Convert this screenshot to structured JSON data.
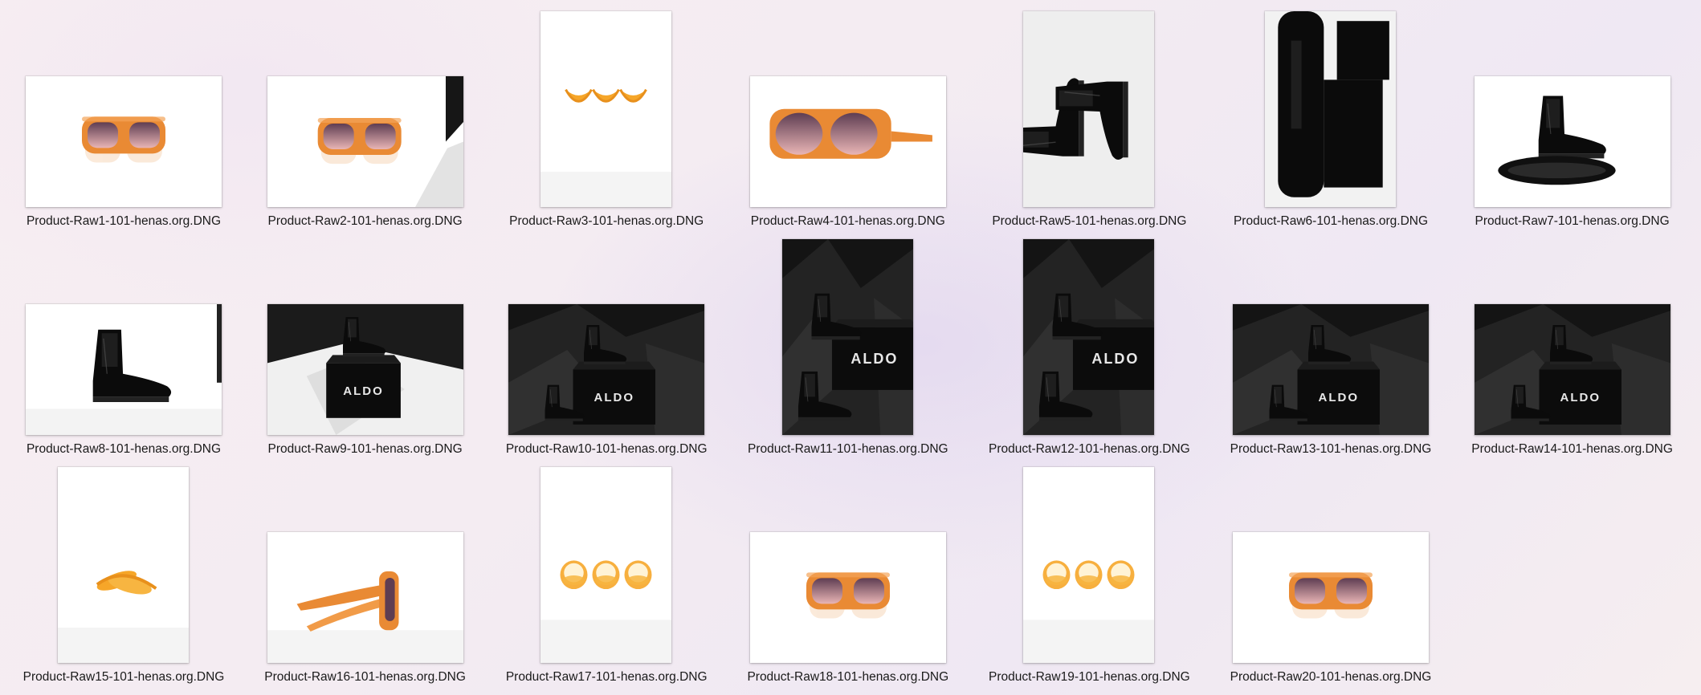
{
  "files": [
    {
      "name": "Product-Raw1-101-henas.org.DNG",
      "orientation": "landscape",
      "subject": "sunglasses-front"
    },
    {
      "name": "Product-Raw2-101-henas.org.DNG",
      "orientation": "landscape",
      "subject": "sunglasses-front-dark-edge"
    },
    {
      "name": "Product-Raw3-101-henas.org.DNG",
      "orientation": "portrait",
      "subject": "lens-triplet-small"
    },
    {
      "name": "Product-Raw4-101-henas.org.DNG",
      "orientation": "landscape",
      "subject": "sunglasses-angled"
    },
    {
      "name": "Product-Raw5-101-henas.org.DNG",
      "orientation": "portrait",
      "subject": "boots-pair-topdown"
    },
    {
      "name": "Product-Raw6-101-henas.org.DNG",
      "orientation": "portrait",
      "subject": "boots-pair-closeup"
    },
    {
      "name": "Product-Raw7-101-henas.org.DNG",
      "orientation": "landscape",
      "subject": "boot-side-and-sole"
    },
    {
      "name": "Product-Raw8-101-henas.org.DNG",
      "orientation": "landscape",
      "subject": "boot-side-white"
    },
    {
      "name": "Product-Raw9-101-henas.org.DNG",
      "orientation": "landscape",
      "subject": "boots-box-white-paper"
    },
    {
      "name": "Product-Raw10-101-henas.org.DNG",
      "orientation": "landscape",
      "subject": "boots-box-dark"
    },
    {
      "name": "Product-Raw11-101-henas.org.DNG",
      "orientation": "portrait",
      "subject": "boots-box-portrait"
    },
    {
      "name": "Product-Raw12-101-henas.org.DNG",
      "orientation": "portrait",
      "subject": "boots-box-portrait"
    },
    {
      "name": "Product-Raw13-101-henas.org.DNG",
      "orientation": "landscape",
      "subject": "boots-box-dark"
    },
    {
      "name": "Product-Raw14-101-henas.org.DNG",
      "orientation": "landscape",
      "subject": "boots-box-dark"
    },
    {
      "name": "Product-Raw15-101-henas.org.DNG",
      "orientation": "portrait",
      "subject": "folded-glasses"
    },
    {
      "name": "Product-Raw16-101-henas.org.DNG",
      "orientation": "landscape",
      "subject": "sunglasses-side"
    },
    {
      "name": "Product-Raw17-101-henas.org.DNG",
      "orientation": "portrait",
      "subject": "lens-triplet"
    },
    {
      "name": "Product-Raw18-101-henas.org.DNG",
      "orientation": "landscape",
      "subject": "sunglasses-front"
    },
    {
      "name": "Product-Raw19-101-henas.org.DNG",
      "orientation": "portrait",
      "subject": "lens-triplet"
    },
    {
      "name": "Product-Raw20-101-henas.org.DNG",
      "orientation": "landscape",
      "subject": "sunglasses-front"
    }
  ],
  "brand_text": "ALDO",
  "colors": {
    "frame_orange": "#e98a34",
    "lens_top": "#5e3d52",
    "lens_bottom": "#e9b5b5",
    "leather": "#0b0b0b",
    "studio_white": "#ffffff"
  }
}
